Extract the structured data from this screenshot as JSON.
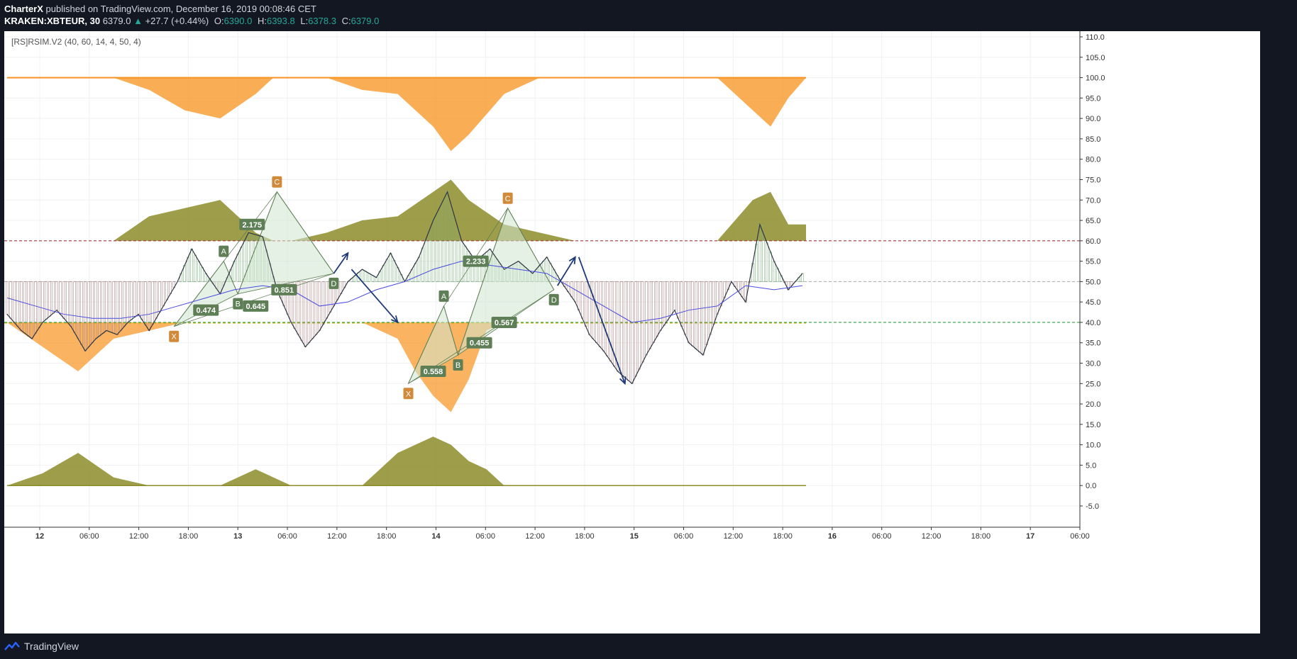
{
  "header": {
    "author": "CharterX",
    "published_text": "published on TradingView.com, December 16, 2019 00:08:46 CET",
    "symbol": "KRAKEN:XBTEUR, 30",
    "last": "6379.0",
    "up_arrow": "▲",
    "change": "+27.7 (+0.44%)",
    "o_label": "O:",
    "o": "6390.0",
    "h_label": "H:",
    "h": "6393.8",
    "l_label": "L:",
    "l": "6378.3",
    "c_label": "C:",
    "c": "6379.0"
  },
  "indicator_label": "[RS]RSIM.V2 (40, 60, 14, 4, 50, 4)",
  "footer": {
    "brand": "TradingView",
    "logo_icon": "tradingview-logo-icon"
  },
  "colors": {
    "orange": "#f7931e",
    "olive": "#8c8c2a",
    "rsi_line": "#2f3542",
    "signal_line": "#4a4ae0",
    "harmonic_fill": "#cfe6cf",
    "label_green": "#5e7f56",
    "label_orange": "#d08a3a",
    "arrow": "#1f3a78",
    "line_60": "#a33a3a",
    "line_40_a": "#2ea043",
    "line_40_b": "#d4b000"
  },
  "chart_data": {
    "type": "area",
    "y_range": [
      -5,
      110
    ],
    "y_ticks": [
      "110.0",
      "105.0",
      "100.0",
      "95.0",
      "90.0",
      "85.0",
      "80.0",
      "75.0",
      "70.0",
      "65.0",
      "60.0",
      "55.0",
      "50.0",
      "45.0",
      "40.0",
      "35.0",
      "30.0",
      "25.0",
      "20.0",
      "15.0",
      "10.0",
      "5.0",
      "0.0",
      "-5.0"
    ],
    "x_ticks": [
      "12",
      "06:00",
      "12:00",
      "18:00",
      "13",
      "06:00",
      "12:00",
      "18:00",
      "14",
      "06:00",
      "12:00",
      "18:00",
      "15",
      "06:00",
      "12:00",
      "18:00",
      "16",
      "06:00",
      "12:00",
      "18:00",
      "17",
      "06:00"
    ],
    "x_range_bars": [
      0,
      225
    ],
    "levels": {
      "upper": 60,
      "mid": 50,
      "lower": 40
    },
    "series": [
      {
        "key": "rsi",
        "x": [
          0,
          4,
          7,
          10,
          14,
          18,
          22,
          25,
          28,
          31,
          34,
          37,
          40,
          44,
          48,
          52,
          56,
          60,
          64,
          68,
          72,
          76,
          80,
          84,
          88,
          92,
          96,
          100,
          104,
          108,
          112,
          116,
          120,
          124,
          128,
          132,
          136,
          140,
          144,
          148,
          152,
          156,
          160,
          164,
          168,
          172,
          176,
          180,
          184,
          188,
          192,
          196,
          200,
          204,
          208,
          212,
          216,
          220,
          224
        ],
        "y": [
          42,
          38,
          36,
          40,
          43,
          39,
          33,
          36,
          38,
          37,
          40,
          42,
          38,
          44,
          50,
          58,
          52,
          47,
          55,
          62,
          61,
          48,
          40,
          34,
          38,
          44,
          50,
          53,
          51,
          57,
          50,
          56,
          65,
          72,
          60,
          55,
          58,
          53,
          55,
          52,
          56,
          50,
          45,
          37,
          33,
          28,
          25,
          32,
          38,
          43,
          35,
          32,
          42,
          50,
          45,
          64,
          55,
          48,
          52
        ]
      },
      {
        "key": "signal",
        "x": [
          0,
          8,
          16,
          24,
          32,
          40,
          48,
          56,
          64,
          72,
          80,
          88,
          96,
          104,
          112,
          120,
          128,
          136,
          144,
          152,
          160,
          168,
          176,
          184,
          192,
          200,
          208,
          216,
          224
        ],
        "y": [
          46,
          44,
          42,
          41,
          41,
          42,
          44,
          46,
          48,
          49,
          48,
          44,
          45,
          48,
          50,
          53,
          55,
          54,
          53,
          52,
          48,
          44,
          40,
          41,
          43,
          44,
          49,
          48,
          49
        ]
      },
      {
        "key": "orange_top",
        "x": [
          0,
          20,
          30,
          40,
          50,
          60,
          70,
          75,
          80,
          90,
          100,
          110,
          120,
          125,
          130,
          140,
          150,
          160,
          170,
          180,
          190,
          200,
          210,
          215,
          220,
          225
        ],
        "y": [
          100,
          100,
          100,
          97,
          92,
          90,
          96,
          100,
          100,
          100,
          97,
          96,
          88,
          82,
          86,
          96,
          100,
          100,
          100,
          100,
          100,
          100,
          92,
          88,
          95,
          100
        ]
      },
      {
        "key": "olive_top",
        "x": [
          0,
          20,
          30,
          40,
          50,
          60,
          70,
          75,
          80,
          90,
          100,
          110,
          120,
          125,
          130,
          140,
          150,
          160,
          170,
          180,
          190,
          200,
          210,
          215,
          220,
          225
        ],
        "y": [
          60,
          60,
          60,
          66,
          68,
          70,
          62,
          60,
          60,
          62,
          65,
          66,
          72,
          75,
          70,
          64,
          62,
          60,
          60,
          60,
          60,
          60,
          70,
          72,
          64,
          64
        ]
      },
      {
        "key": "orange_bottom",
        "x": [
          0,
          10,
          20,
          30,
          40,
          50,
          60,
          70,
          80,
          90,
          100,
          110,
          115,
          120,
          125,
          130,
          135,
          140,
          145,
          150
        ],
        "y": [
          40,
          34,
          28,
          36,
          38,
          40,
          40,
          40,
          40,
          40,
          40,
          36,
          28,
          22,
          18,
          26,
          38,
          40,
          40,
          40
        ]
      },
      {
        "key": "olive_bottom",
        "x": [
          0,
          10,
          20,
          30,
          40,
          50,
          60,
          70,
          80,
          90,
          100,
          110,
          115,
          120,
          125,
          130,
          135,
          140,
          145,
          150
        ],
        "y": [
          0,
          3,
          8,
          2,
          0,
          0,
          0,
          4,
          0,
          0,
          0,
          8,
          10,
          12,
          10,
          6,
          4,
          0,
          0,
          0
        ]
      }
    ],
    "patterns": [
      {
        "points": [
          {
            "name": "X",
            "x": 47,
            "y": 39
          },
          {
            "name": "A",
            "x": 61,
            "y": 55
          },
          {
            "name": "B",
            "x": 65,
            "y": 47
          },
          {
            "name": "C",
            "x": 76,
            "y": 72
          },
          {
            "name": "D",
            "x": 92,
            "y": 52
          }
        ],
        "ratios": [
          {
            "text": "2.175",
            "x": 69,
            "y": 64
          },
          {
            "text": "0.474",
            "x": 56,
            "y": 43
          },
          {
            "text": "0.645",
            "x": 70,
            "y": 44
          },
          {
            "text": "0.851",
            "x": 78,
            "y": 48
          }
        ]
      },
      {
        "points": [
          {
            "name": "X",
            "x": 113,
            "y": 25
          },
          {
            "name": "A",
            "x": 123,
            "y": 44
          },
          {
            "name": "B",
            "x": 127,
            "y": 32
          },
          {
            "name": "C",
            "x": 141,
            "y": 68
          },
          {
            "name": "D",
            "x": 154,
            "y": 48
          }
        ],
        "ratios": [
          {
            "text": "2.233",
            "x": 132,
            "y": 55
          },
          {
            "text": "0.558",
            "x": 120,
            "y": 28
          },
          {
            "text": "0.455",
            "x": 133,
            "y": 35
          },
          {
            "text": "0.567",
            "x": 140,
            "y": 40
          }
        ]
      }
    ],
    "drawn_arrows": [
      {
        "from": [
          92,
          52
        ],
        "to": [
          96,
          57
        ]
      },
      {
        "from": [
          97,
          53
        ],
        "to": [
          110,
          40
        ]
      },
      {
        "from": [
          155,
          49
        ],
        "to": [
          160,
          56
        ]
      },
      {
        "from": [
          161,
          56
        ],
        "to": [
          174,
          25
        ]
      }
    ]
  }
}
